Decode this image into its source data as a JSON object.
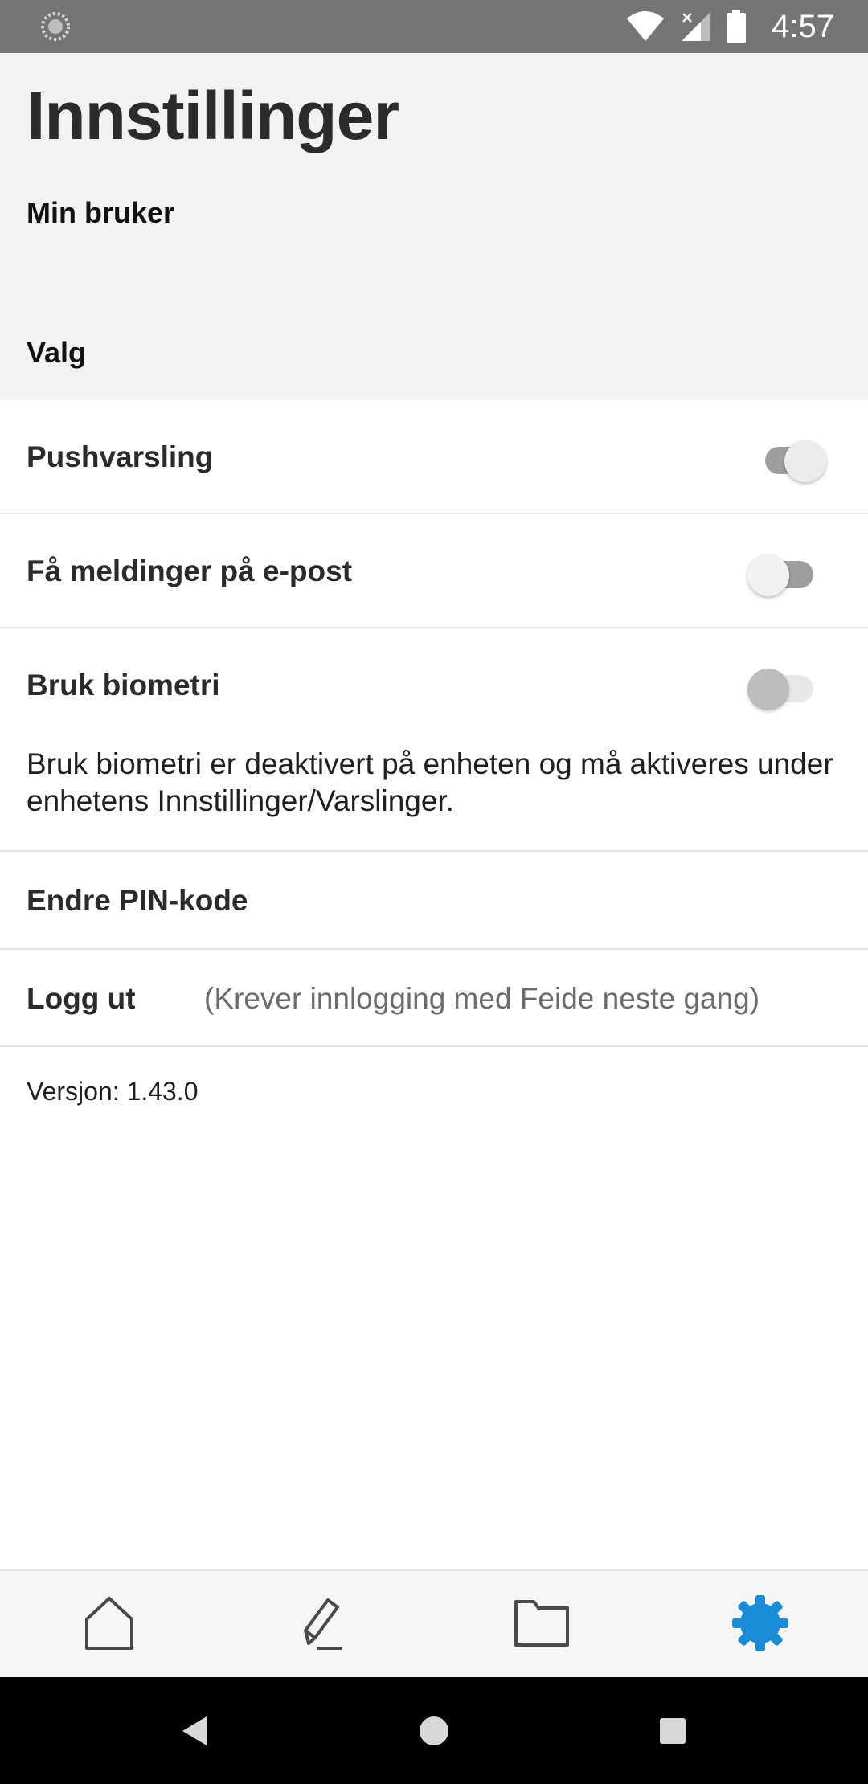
{
  "status_bar": {
    "time": "4:57",
    "icons": [
      "loading-icon",
      "wifi-icon",
      "signal-icon",
      "battery-icon"
    ]
  },
  "header": {
    "title": "Innstillinger",
    "section_account": "Min bruker",
    "section_options": "Valg"
  },
  "settings": {
    "push": {
      "label": "Pushvarsling",
      "enabled": true
    },
    "email": {
      "label": "Få meldinger på e-post",
      "enabled": false
    },
    "biometrics": {
      "label": "Bruk biometri",
      "enabled": false,
      "disabled": true,
      "info": "Bruk biometri er deaktivert på enheten og må aktiveres under enhetens Innstillinger/Varslinger."
    },
    "change_pin": {
      "label": "Endre PIN-kode"
    },
    "logout": {
      "label": "Logg ut",
      "note": "(Krever innlogging med Feide neste gang)"
    }
  },
  "version": "Versjon: 1.43.0",
  "bottom_nav": {
    "items": [
      {
        "icon": "home-icon",
        "active": false
      },
      {
        "icon": "pencil-icon",
        "active": false
      },
      {
        "icon": "folder-icon",
        "active": false
      },
      {
        "icon": "settings-gear-icon",
        "active": true
      }
    ]
  },
  "colors": {
    "accent": "#1a8bd6",
    "status_bar": "#757575",
    "header_bg": "#f2f2f2",
    "system_nav": "#000000"
  }
}
